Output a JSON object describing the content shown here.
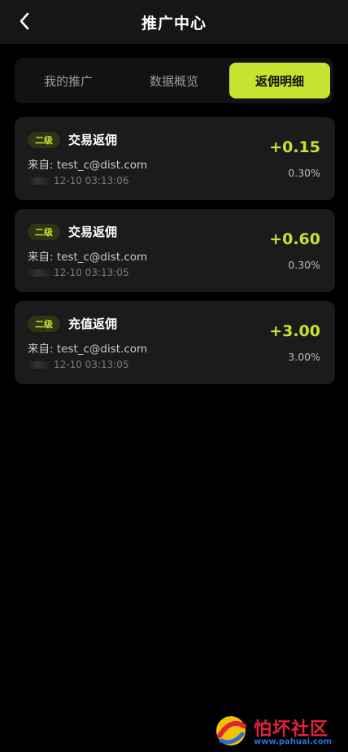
{
  "header": {
    "title": "推广中心",
    "back_icon": "chevron-left-icon"
  },
  "tabs": [
    {
      "label": "我的推广",
      "active": false
    },
    {
      "label": "数据概览",
      "active": false
    },
    {
      "label": "返佣明细",
      "active": true
    }
  ],
  "accent_color": "#c5e32f",
  "records": [
    {
      "level": "二级",
      "title": "交易返佣",
      "from": "来自: test_c@dist.com",
      "time": "12-10 03:13:06",
      "amount": "+0.15",
      "rate": "0.30%"
    },
    {
      "level": "二级",
      "title": "交易返佣",
      "from": "来自: test_c@dist.com",
      "time": "12-10 03:13:05",
      "amount": "+0.60",
      "rate": "0.30%"
    },
    {
      "level": "二级",
      "title": "充值返佣",
      "from": "来自: test_c@dist.com",
      "time": "12-10 03:13:05",
      "amount": "+3.00",
      "rate": "3.00%"
    }
  ],
  "watermark": {
    "name": "怕坏社区",
    "url": "www.pahuai.com"
  }
}
